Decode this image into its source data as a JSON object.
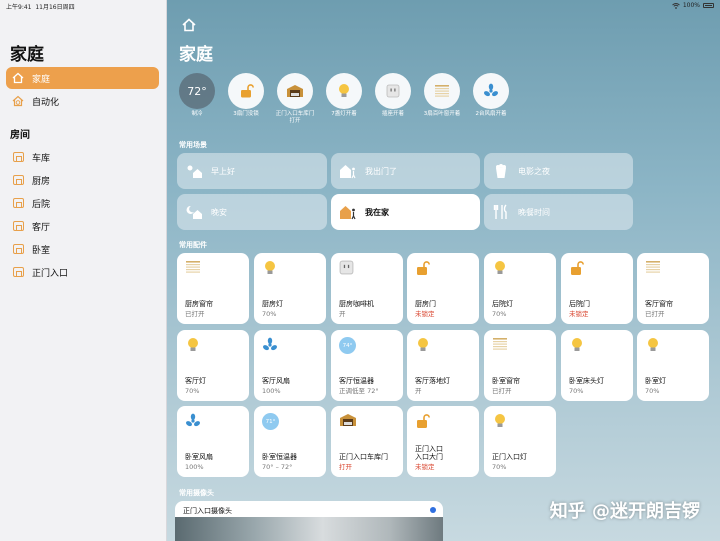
{
  "status_bar": {
    "time": "上午9:41",
    "date": "11月16日周四",
    "battery": "100%"
  },
  "sidebar": {
    "title": "家庭",
    "items": [
      {
        "label": "家庭",
        "icon": "house-icon",
        "active": true
      },
      {
        "label": "自动化",
        "icon": "clock-icon",
        "active": false
      }
    ],
    "rooms_heading": "房间",
    "rooms": [
      "车库",
      "厨房",
      "后院",
      "客厅",
      "卧室",
      "正门入口"
    ]
  },
  "main": {
    "title": "家庭",
    "status": [
      {
        "label": "制冷",
        "value": "72°",
        "icon": "thermostat-icon"
      },
      {
        "label": "3扇门没锁",
        "icon": "lock-open-icon"
      },
      {
        "label": "正门入口车库门\n打开",
        "icon": "garage-icon"
      },
      {
        "label": "7盏灯开着",
        "icon": "bulb-icon"
      },
      {
        "label": "插座开着",
        "icon": "outlet-icon"
      },
      {
        "label": "3扇百叶窗开着",
        "icon": "blinds-icon"
      },
      {
        "label": "2台风扇开着",
        "icon": "fan-icon"
      }
    ],
    "scenes_heading": "常用场景",
    "scenes": [
      {
        "label": "早上好",
        "icon": "morning-icon",
        "active": false
      },
      {
        "label": "我出门了",
        "icon": "leave-home-icon",
        "active": false
      },
      {
        "label": "电影之夜",
        "icon": "popcorn-icon",
        "active": false
      },
      {
        "label": "晚安",
        "icon": "night-icon",
        "active": false
      },
      {
        "label": "我在家",
        "icon": "arrive-home-icon",
        "active": true
      },
      {
        "label": "晚餐时间",
        "icon": "dinner-icon",
        "active": false
      }
    ],
    "accessories_heading": "常用配件",
    "accessories": [
      {
        "name": "厨房窗帘",
        "state": "已打开",
        "icon": "blinds-icon",
        "red": false
      },
      {
        "name": "厨房灯",
        "state": "70%",
        "icon": "bulb-icon",
        "red": false
      },
      {
        "name": "厨房咖啡机",
        "state": "开",
        "icon": "outlet-icon",
        "red": false
      },
      {
        "name": "厨房门",
        "state": "未锁定",
        "icon": "lock-open-icon",
        "red": true
      },
      {
        "name": "后院灯",
        "state": "70%",
        "icon": "bulb-icon",
        "red": false
      },
      {
        "name": "后院门",
        "state": "未锁定",
        "icon": "lock-open-icon",
        "red": true
      },
      {
        "name": "客厅窗帘",
        "state": "已打开",
        "icon": "blinds-icon",
        "red": false
      },
      {
        "name": "客厅灯",
        "state": "70%",
        "icon": "bulb-icon",
        "red": false
      },
      {
        "name": "客厅风扇",
        "state": "100%",
        "icon": "fan-icon",
        "red": false
      },
      {
        "name": "客厅恒温器",
        "state": "正调低至 72°",
        "icon": "thermostat-icon",
        "badge": "74°",
        "red": false
      },
      {
        "name": "客厅落地灯",
        "state": "开",
        "icon": "bulb-icon",
        "red": false
      },
      {
        "name": "卧室窗帘",
        "state": "已打开",
        "icon": "blinds-icon",
        "red": false
      },
      {
        "name": "卧室床头灯",
        "state": "70%",
        "icon": "bulb-icon",
        "red": false
      },
      {
        "name": "卧室灯",
        "state": "70%",
        "icon": "bulb-icon",
        "red": false
      },
      {
        "name": "卧室风扇",
        "state": "100%",
        "icon": "fan-icon",
        "red": false
      },
      {
        "name": "卧室恒温器",
        "state": "70° – 72°",
        "icon": "thermostat-icon",
        "badge": "71°",
        "red": false
      },
      {
        "name": "正门入口车库门",
        "state": "打开",
        "icon": "garage-icon",
        "red": true
      },
      {
        "name": "正门入口\n入口大门",
        "state": "未锁定",
        "icon": "lock-open-icon",
        "red": true
      },
      {
        "name": "正门入口灯",
        "state": "70%",
        "icon": "bulb-icon",
        "red": false
      }
    ],
    "cameras_heading": "常用摄像头",
    "camera": {
      "title": "正门入口摄像头"
    }
  },
  "watermark": "知乎 @迷开朗吉锣",
  "colors": {
    "accent": "#eda04c",
    "bulb": "#f5c542",
    "lock": "#e8a030",
    "fan": "#3a8fd0",
    "red": "#d9442e"
  }
}
